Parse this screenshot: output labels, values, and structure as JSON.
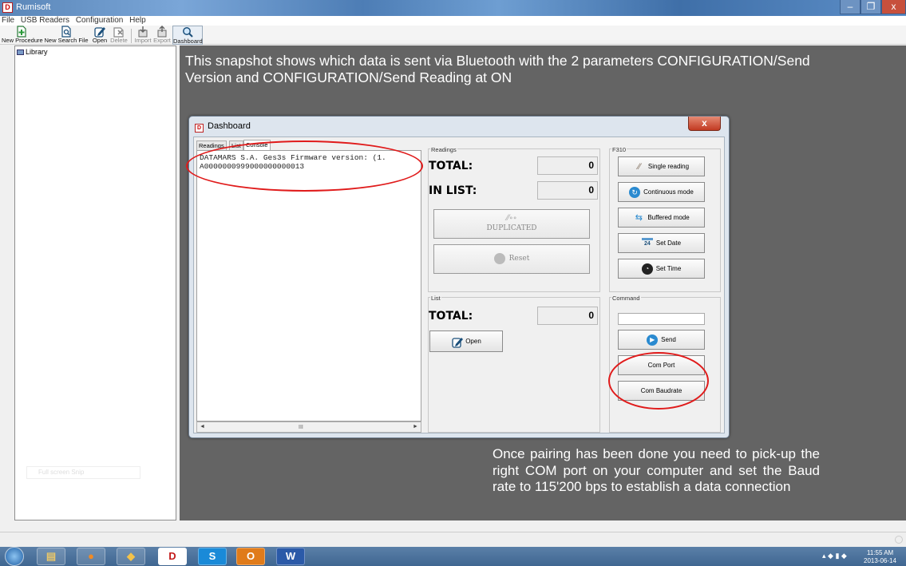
{
  "window": {
    "title": "Rumisoft",
    "min_glyph": "–",
    "max_glyph": "❐",
    "close_glyph": "x"
  },
  "menubar": {
    "items": [
      "File",
      "USB Readers",
      "Configuration",
      "Help"
    ]
  },
  "toolbar": {
    "new_procedure": "New Procedure",
    "new_search_file": "New Search File",
    "open": "Open",
    "delete": "Delete",
    "import": "Import",
    "export": "Export",
    "dashboard": "Dashboard"
  },
  "sidebar": {
    "library_label": "Library",
    "ghost_button": "Full screen Snip"
  },
  "annotations": {
    "top": "This snapshot shows which data is sent via Bluetooth with the 2 parameters CONFIGURATION/Send Version and CONFIGURATION/Send Reading at ON",
    "bottom": "Once pairing has been done you need to pick-up the right COM port on your computer and set the Baud rate to 115'200 bps to establish a data connection"
  },
  "dashboard": {
    "title": "Dashboard",
    "close_glyph": "x",
    "tabs": [
      "Readings",
      "List",
      "Console"
    ],
    "console_lines": [
      "DATAMARS S.A. Ges3s Firmware version: (1.",
      "A0000000999000000000013"
    ],
    "scroll_thumb": "III",
    "readings": {
      "group_label": "Readings",
      "total_label": "TOTAL:",
      "total_value": "0",
      "in_list_label": "IN LIST:",
      "in_list_value": "0",
      "duplicated_label": "DUPLICATED",
      "reset_label": "Reset"
    },
    "list": {
      "group_label": "List",
      "total_label": "TOTAL:",
      "total_value": "0",
      "open_label": "Open"
    },
    "f310": {
      "group_label": "F310",
      "single_reading": "Single reading",
      "continuous_mode": "Continuous mode",
      "buffered_mode": "Buffered mode",
      "set_date": "Set Date",
      "set_time": "Set Time"
    },
    "command": {
      "group_label": "Command",
      "input_value": "",
      "send": "Send",
      "com_port": "Com Port",
      "com_baudrate": "Com Baudrate"
    }
  },
  "taskbar": {
    "apps": [
      "explorer",
      "firefox",
      "folder",
      "D",
      "S",
      "O",
      "W"
    ],
    "time": "11:55 AM",
    "date": "2013-06-14"
  }
}
